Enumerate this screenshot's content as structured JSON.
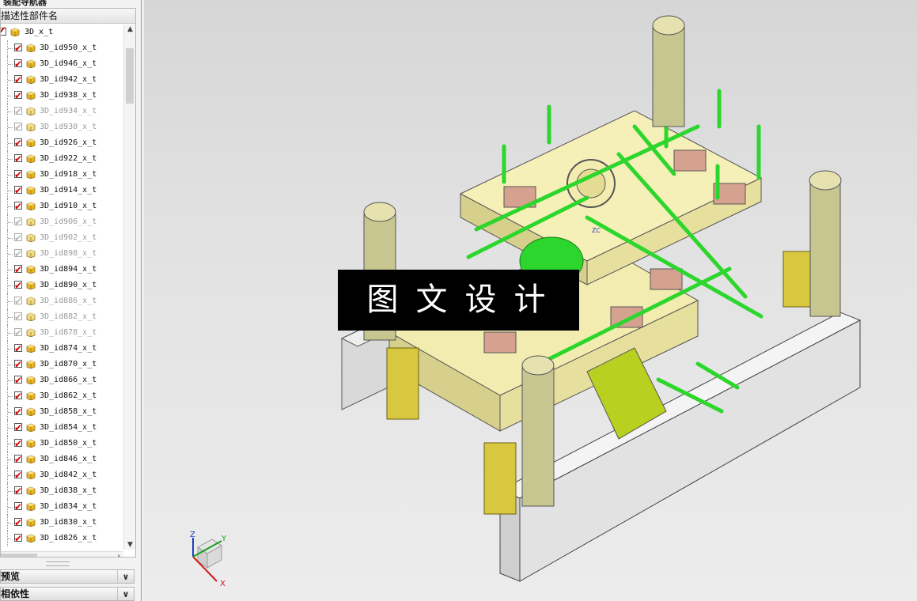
{
  "panel": {
    "title": "装配导航器",
    "column_header": "描述性部件名",
    "root": {
      "label": "3D_x_t",
      "checked": true
    },
    "items": [
      {
        "label": "3D_id950_x_t",
        "checked": true
      },
      {
        "label": "3D_id946_x_t",
        "checked": true
      },
      {
        "label": "3D_id942_x_t",
        "checked": true
      },
      {
        "label": "3D_id938_x_t",
        "checked": true
      },
      {
        "label": "3D_id934_x_t",
        "checked": false
      },
      {
        "label": "3D_id930_x_t",
        "checked": false
      },
      {
        "label": "3D_id926_x_t",
        "checked": true
      },
      {
        "label": "3D_id922_x_t",
        "checked": true
      },
      {
        "label": "3D_id918_x_t",
        "checked": true
      },
      {
        "label": "3D_id914_x_t",
        "checked": true
      },
      {
        "label": "3D_id910_x_t",
        "checked": true
      },
      {
        "label": "3D_id906_x_t",
        "checked": false
      },
      {
        "label": "3D_id902_x_t",
        "checked": false
      },
      {
        "label": "3D_id898_x_t",
        "checked": false
      },
      {
        "label": "3D_id894_x_t",
        "checked": true
      },
      {
        "label": "3D_id890_x_t",
        "checked": true
      },
      {
        "label": "3D_id886_x_t",
        "checked": false
      },
      {
        "label": "3D_id882_x_t",
        "checked": false
      },
      {
        "label": "3D_id878_x_t",
        "checked": false
      },
      {
        "label": "3D_id874_x_t",
        "checked": true
      },
      {
        "label": "3D_id870_x_t",
        "checked": true
      },
      {
        "label": "3D_id866_x_t",
        "checked": true
      },
      {
        "label": "3D_id862_x_t",
        "checked": true
      },
      {
        "label": "3D_id858_x_t",
        "checked": true
      },
      {
        "label": "3D_id854_x_t",
        "checked": true
      },
      {
        "label": "3D_id850_x_t",
        "checked": true
      },
      {
        "label": "3D_id846_x_t",
        "checked": true
      },
      {
        "label": "3D_id842_x_t",
        "checked": true
      },
      {
        "label": "3D_id838_x_t",
        "checked": true
      },
      {
        "label": "3D_id834_x_t",
        "checked": true
      },
      {
        "label": "3D_id830_x_t",
        "checked": true
      },
      {
        "label": "3D_id826_x_t",
        "checked": true
      }
    ],
    "sections": [
      {
        "label": "预览"
      },
      {
        "label": "相依性"
      }
    ]
  },
  "viewport": {
    "watermark": "图文设计",
    "triad": {
      "x": "X",
      "y": "Y",
      "z": "Z",
      "zc": "ZC"
    }
  },
  "colors": {
    "plate": "#f2ecb0",
    "green_pin": "#2dd62d",
    "spring": "#d8c840",
    "block": "#e4e4e4",
    "insert": "#d6a290",
    "check": "#d00000"
  }
}
